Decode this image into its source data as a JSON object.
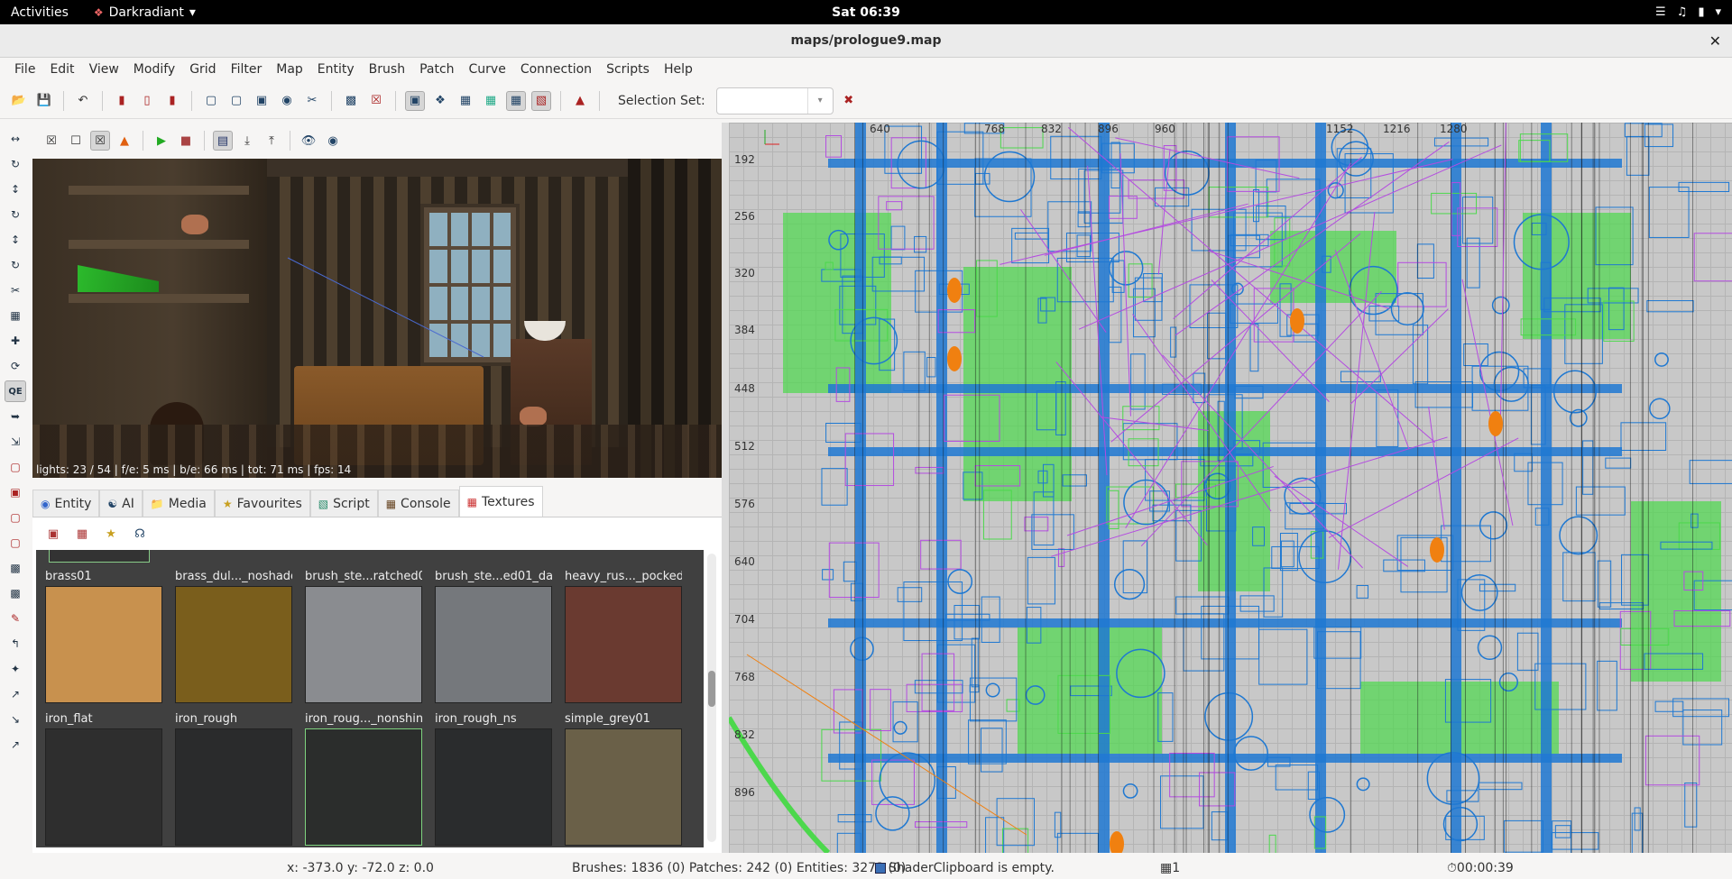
{
  "system": {
    "activities": "Activities",
    "app_name": "Darkradiant",
    "clock": "Sat 06:39"
  },
  "window": {
    "title": "maps/prologue9.map"
  },
  "menu": [
    "File",
    "Edit",
    "View",
    "Modify",
    "Grid",
    "Filter",
    "Map",
    "Entity",
    "Brush",
    "Patch",
    "Curve",
    "Connection",
    "Scripts",
    "Help"
  ],
  "toolbar": {
    "selection_set_label": "Selection Set:",
    "selection_set_value": ""
  },
  "camera": {
    "stats": "lights: 23 / 54 | f/e: 5 ms | b/e: 66 ms | tot: 71 ms | fps: 14"
  },
  "tabs": [
    {
      "label": "Entity",
      "icon": "entity-icon"
    },
    {
      "label": "AI",
      "icon": "ai-icon"
    },
    {
      "label": "Media",
      "icon": "folder-icon"
    },
    {
      "label": "Favourites",
      "icon": "star-icon"
    },
    {
      "label": "Script",
      "icon": "script-icon"
    },
    {
      "label": "Console",
      "icon": "console-icon"
    },
    {
      "label": "Textures",
      "icon": "textures-icon",
      "active": true
    }
  ],
  "textures": [
    {
      "label": "brass01",
      "color": "#c8914e"
    },
    {
      "label": "brass_dul..._noshadow",
      "color": "#7a5e1c"
    },
    {
      "label": "brush_ste...ratched01",
      "color": "#8a8c90"
    },
    {
      "label": "brush_ste...ed01_dark",
      "color": "#75787c"
    },
    {
      "label": "heavy_rus..._pocked01",
      "color": "#6a3a30"
    },
    {
      "label": "iron_flat",
      "color": "#2e2e2e"
    },
    {
      "label": "iron_rough",
      "color": "#2a2b2c"
    },
    {
      "label": "iron_roug..._nonshiny",
      "color": "#2b2d2c",
      "selected": true
    },
    {
      "label": "iron_rough_ns",
      "color": "#2a2c2d"
    },
    {
      "label": "simple_grey01",
      "color": "#6a6048"
    }
  ],
  "ortho": {
    "top_ruler": [
      "640",
      "768",
      "832",
      "896",
      "960",
      "1152",
      "1216",
      "1280"
    ],
    "left_ruler": [
      "192",
      "256",
      "320",
      "384",
      "448",
      "512",
      "576",
      "640",
      "704",
      "768",
      "832",
      "896"
    ]
  },
  "status": {
    "coords": "x:  -373.0 y:  -72.0 z:    0.0",
    "counts": "Brushes: 1836 (0) Patches: 242 (0) Entities: 3273 (0)",
    "clipboard": "ShaderClipboard is empty.",
    "grid": "1",
    "timer": "00:00:39"
  },
  "colors": {
    "ortho_brush": "#1e78d2",
    "ortho_brush_green": "#4cd84c",
    "ortho_entity": "#b44ce0",
    "ortho_light": "#f08010"
  }
}
